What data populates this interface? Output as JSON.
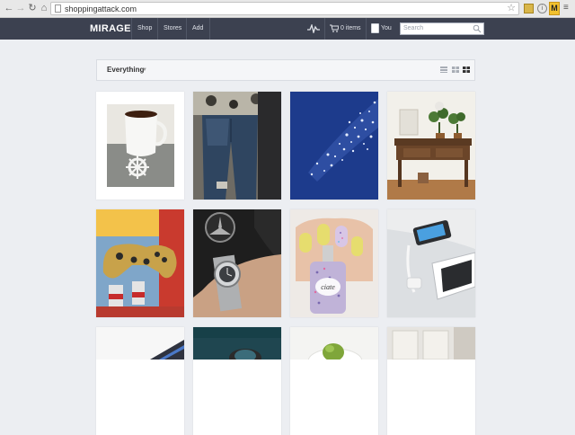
{
  "browser": {
    "url": "shoppingattack.com",
    "back_icon": "back-arrow-icon",
    "forward_icon": "forward-arrow-icon",
    "reload_icon": "reload-icon",
    "home_icon": "home-icon",
    "bookmark_icon": "star-icon",
    "extension_badge_letter": "M"
  },
  "header": {
    "brand": "MIRAGE",
    "nav": [
      "Shop",
      "Stores",
      "Add"
    ],
    "cart_label": "0 items",
    "user_label": "You",
    "search_placeholder": "Search"
  },
  "filter": {
    "label": "Everything",
    "views": [
      "list-view",
      "medium-grid-view",
      "large-grid-view"
    ],
    "active_view": "large-grid-view"
  },
  "products": [
    {
      "id": "teacup",
      "description": "white teacup with ship wheel"
    },
    {
      "id": "jeans",
      "description": "ripped blue jeans with floral shirt"
    },
    {
      "id": "glitter",
      "description": "navy blue glitter"
    },
    {
      "id": "console-table",
      "description": "wooden console table with plants"
    },
    {
      "id": "game-controller",
      "description": "gold game controller"
    },
    {
      "id": "watch",
      "description": "silver wristwatch in car"
    },
    {
      "id": "nail-polish",
      "description": "yellow nail polish bottle"
    },
    {
      "id": "tablet-dock",
      "description": "white tablet dock with phone"
    },
    {
      "id": "row3-1",
      "description": "partial product image"
    },
    {
      "id": "row3-2",
      "description": "partial product image"
    },
    {
      "id": "row3-3",
      "description": "partial product image"
    },
    {
      "id": "row3-4",
      "description": "partial product image"
    }
  ],
  "colors": {
    "header_bg": "#3c4150",
    "page_bg": "#eceef2",
    "extension_badge": "#f2c12e"
  }
}
